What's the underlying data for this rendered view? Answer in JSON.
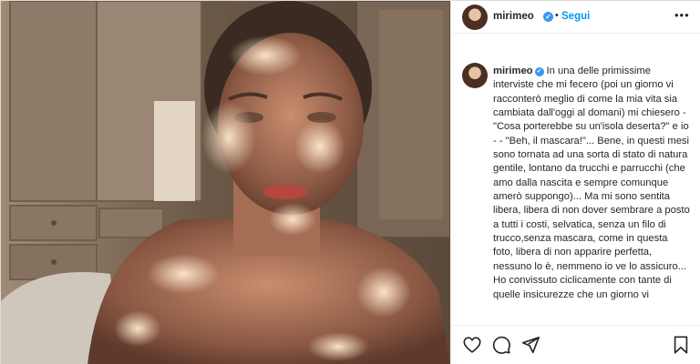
{
  "post": {
    "username": "mirimeo",
    "follow_label": "Segui",
    "separator": "•",
    "more_label": "•••",
    "verified_mark": "✓"
  },
  "caption": {
    "username": "mirimeo",
    "text": "In una delle primissime interviste che mi fecero (poi un giorno vi racconterò meglio di come la mia vita sia cambiata dall'oggi al domani) mi chiesero - \"Cosa porterebbe su un'isola deserta?\" e io - - \"Beh, il mascara!\"... Bene, in questi mesi sono tornata ad una sorta di stato di natura gentile, lontano da trucchi e parrucchi (che amo dalla nascita e sempre comunque amerò suppongo)... Ma mi sono sentita libera, libera di non dover sembrare a posto a tutti i costi, selvatica, senza un filo di trucco,senza mascara, come in questa foto, libera di non apparire perfetta, nessuno lo è, nemmeno io ve lo assicuro... Ho convissuto ciclicamente con tante di quelle insicurezze che un giorno vi"
  },
  "icons": {
    "verified": "verified-badge-icon",
    "like": "heart-icon",
    "comment": "comment-icon",
    "share": "paper-plane-icon",
    "save": "bookmark-icon",
    "more": "more-options-icon"
  },
  "colors": {
    "link_blue": "#0095f6",
    "verified_blue": "#3897f0",
    "text": "#262626",
    "border": "#efefef"
  }
}
